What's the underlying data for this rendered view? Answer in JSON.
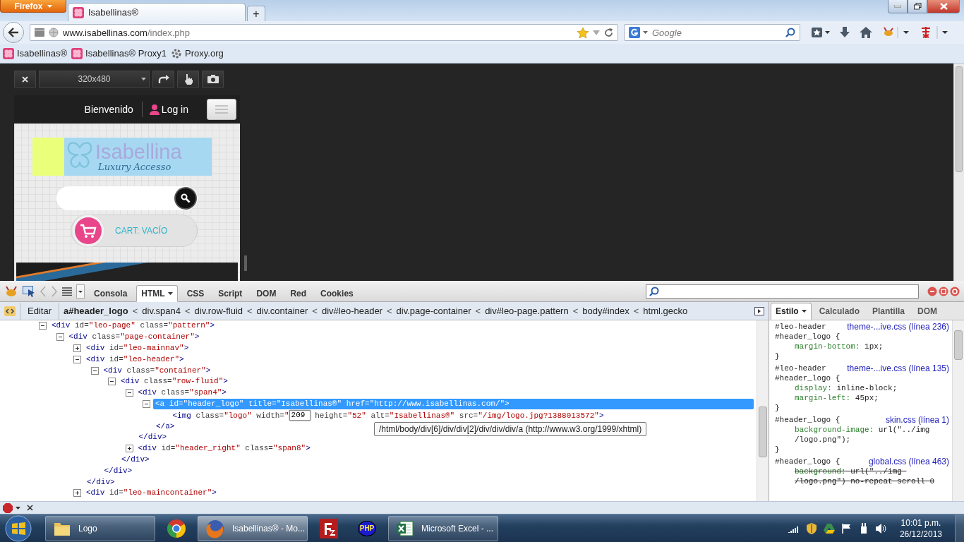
{
  "browser": {
    "app_button": "Firefox",
    "tabs": [
      {
        "title": "Isabellinas®",
        "selected": true
      }
    ],
    "new_tab": "+",
    "url": {
      "host": "www.isabellinas.com",
      "path": "/index.php"
    },
    "search": {
      "placeholder": "Google"
    },
    "bookmarks": [
      {
        "label": "Isabellinas®",
        "kind": "site"
      },
      {
        "label": "Isabellinas® Proxy1",
        "kind": "site"
      },
      {
        "label": "Proxy.org",
        "kind": "proxy"
      }
    ]
  },
  "responsive": {
    "size": "320x480"
  },
  "preview": {
    "welcome": "Bienvenido",
    "login": "Log in",
    "logo_title": "Isabellina",
    "logo_subtitle": "Luxury Accesso",
    "cart": "CART: VACÍO"
  },
  "devtools": {
    "tabs": [
      {
        "label": "Consola",
        "selected": false
      },
      {
        "label": "HTML",
        "selected": true
      },
      {
        "label": "CSS",
        "selected": false
      },
      {
        "label": "Script",
        "selected": false
      },
      {
        "label": "DOM",
        "selected": false
      },
      {
        "label": "Red",
        "selected": false
      },
      {
        "label": "Cookies",
        "selected": false
      }
    ],
    "breadcrumb": {
      "edit": "Editar",
      "separator": "<",
      "items": [
        {
          "label": "a#header_logo",
          "selected": true
        },
        {
          "label": "div.span4",
          "selected": false
        },
        {
          "label": "div.row-fluid",
          "selected": false
        },
        {
          "label": "div.container",
          "selected": false
        },
        {
          "label": "div#leo-header",
          "selected": false
        },
        {
          "label": "div.page-container",
          "selected": false
        },
        {
          "label": "div#leo-page.pattern",
          "selected": false
        },
        {
          "label": "body#index",
          "selected": false
        },
        {
          "label": "html.gecko",
          "selected": false
        }
      ]
    },
    "tree": [
      {
        "expanded": true,
        "selected": false,
        "tokens": [
          {
            "kind": "tag",
            "text": "<div"
          },
          {
            "kind": "attr",
            "text": " id="
          },
          {
            "kind": "value",
            "text": "\"leo-page\""
          },
          {
            "kind": "attr",
            "text": " class="
          },
          {
            "kind": "value",
            "text": "\"pattern\""
          },
          {
            "kind": "tag",
            "text": ">"
          }
        ],
        "children": [
          {
            "expanded": true,
            "selected": false,
            "tokens": [
              {
                "kind": "tag",
                "text": "<div"
              },
              {
                "kind": "attr",
                "text": " class="
              },
              {
                "kind": "value",
                "text": "\"page-container\""
              },
              {
                "kind": "tag",
                "text": ">"
              }
            ],
            "children": [
              {
                "expanded": false,
                "selected": false,
                "tokens": [
                  {
                    "kind": "tag",
                    "text": "<div"
                  },
                  {
                    "kind": "attr",
                    "text": " id="
                  },
                  {
                    "kind": "value",
                    "text": "\"leo-mainnav\""
                  },
                  {
                    "kind": "tag",
                    "text": ">"
                  }
                ]
              },
              {
                "expanded": true,
                "selected": false,
                "tokens": [
                  {
                    "kind": "tag",
                    "text": "<div"
                  },
                  {
                    "kind": "attr",
                    "text": " id="
                  },
                  {
                    "kind": "value",
                    "text": "\"leo-header\""
                  },
                  {
                    "kind": "tag",
                    "text": ">"
                  }
                ],
                "close": "</div>",
                "children": [
                  {
                    "expanded": true,
                    "selected": false,
                    "tokens": [
                      {
                        "kind": "tag",
                        "text": "<div"
                      },
                      {
                        "kind": "attr",
                        "text": " class="
                      },
                      {
                        "kind": "value",
                        "text": "\"container\""
                      },
                      {
                        "kind": "tag",
                        "text": ">"
                      }
                    ],
                    "close": "</div>",
                    "children": [
                      {
                        "expanded": true,
                        "selected": false,
                        "tokens": [
                          {
                            "kind": "tag",
                            "text": "<div"
                          },
                          {
                            "kind": "attr",
                            "text": " class="
                          },
                          {
                            "kind": "value",
                            "text": "\"row-fluid\""
                          },
                          {
                            "kind": "tag",
                            "text": ">"
                          }
                        ],
                        "close": "</div>",
                        "children": [
                          {
                            "expanded": true,
                            "selected": false,
                            "tokens": [
                              {
                                "kind": "tag",
                                "text": "<div"
                              },
                              {
                                "kind": "attr",
                                "text": " class="
                              },
                              {
                                "kind": "value",
                                "text": "\"span4\""
                              },
                              {
                                "kind": "tag",
                                "text": ">"
                              }
                            ],
                            "close": "</div>",
                            "children": [
                              {
                                "expanded": true,
                                "selected": true,
                                "tokens": [
                                  {
                                    "text": "<a id=\"header_logo\" title=\"Isabellinas®\" href=\"http://www.isabellinas.com/\">"
                                  }
                                ],
                                "close": "</a>",
                                "children": [
                                  {
                                    "selected": false,
                                    "tokens": [
                                      {
                                        "kind": "tag",
                                        "text": "<img"
                                      },
                                      {
                                        "kind": "attr",
                                        "text": " class="
                                      },
                                      {
                                        "kind": "value",
                                        "text": "\"logo\""
                                      },
                                      {
                                        "kind": "attr",
                                        "text": " width="
                                      },
                                      {
                                        "kind": "value",
                                        "text": "\""
                                      },
                                      {
                                        "kind": "editor",
                                        "text": "209"
                                      },
                                      {
                                        "kind": "attr",
                                        "text": " height="
                                      },
                                      {
                                        "kind": "value",
                                        "text": "\"52\""
                                      },
                                      {
                                        "kind": "attr",
                                        "text": " alt="
                                      },
                                      {
                                        "kind": "value",
                                        "text": "\"Isabellinas®\""
                                      },
                                      {
                                        "kind": "attr",
                                        "text": " src="
                                      },
                                      {
                                        "kind": "value",
                                        "text": "\"/img/logo.jpg?1388013572\""
                                      },
                                      {
                                        "kind": "tag",
                                        "text": ">"
                                      }
                                    ]
                                  }
                                ]
                              }
                            ]
                          },
                          {
                            "expanded": false,
                            "selected": false,
                            "tokens": [
                              {
                                "kind": "tag",
                                "text": "<div"
                              },
                              {
                                "kind": "attr",
                                "text": " id="
                              },
                              {
                                "kind": "value",
                                "text": "\"header_right\""
                              },
                              {
                                "kind": "attr",
                                "text": " class="
                              },
                              {
                                "kind": "value",
                                "text": "\"span8\""
                              },
                              {
                                "kind": "tag",
                                "text": ">"
                              }
                            ]
                          }
                        ]
                      }
                    ]
                  }
                ]
              },
              {
                "expanded": false,
                "selected": false,
                "tokens": [
                  {
                    "kind": "tag",
                    "text": "<div"
                  },
                  {
                    "kind": "attr",
                    "text": " id="
                  },
                  {
                    "kind": "value",
                    "text": "\"leo-maincontainer\""
                  },
                  {
                    "kind": "tag",
                    "text": ">"
                  }
                ]
              }
            ]
          }
        ]
      }
    ],
    "tooltip": "/html/body/div[6]/div/div[2]/div/div/div/a (http://www.w3.org/1999/xhtml)",
    "side_tabs": [
      {
        "label": "Estilo",
        "selected": true
      },
      {
        "label": "Calculado",
        "selected": false
      },
      {
        "label": "Plantilla",
        "selected": false
      },
      {
        "label": "DOM",
        "selected": false
      }
    ],
    "rules": [
      {
        "selector": [
          "#leo-header",
          "#header_logo {"
        ],
        "source": "theme-...ive.css (línea 236)",
        "declarations": [
          {
            "property": "margin-bottom:",
            "value": "1px;",
            "overridden": false
          }
        ],
        "close": "}"
      },
      {
        "selector": [
          "#leo-header",
          "#header_logo {"
        ],
        "source": "theme-...ive.css (línea 135)",
        "declarations": [
          {
            "property": "display:",
            "value": "inline-block;",
            "overridden": false
          },
          {
            "property": "margin-left:",
            "value": "45px;",
            "overridden": false
          }
        ],
        "close": "}"
      },
      {
        "selector": [
          "#header_logo {"
        ],
        "source": "skin.css (línea 1)",
        "declarations": [
          {
            "property": "background-image:",
            "value": "url(\"../img /logo.png\");",
            "overridden": false
          }
        ],
        "close": "}"
      },
      {
        "selector": [
          "#header_logo {"
        ],
        "source": "global.css (línea 463)",
        "declarations": [
          {
            "property": "background:",
            "value": "url(\"../img /logo.png\") no-repeat scroll 0",
            "overridden": true
          }
        ]
      }
    ]
  },
  "taskbar": {
    "items": [
      {
        "kind": "folder",
        "label": "Logo",
        "running": true,
        "selected": false
      },
      {
        "kind": "chrome",
        "running": false,
        "selected": false
      },
      {
        "kind": "firefox",
        "label": "Isabellinas® - Mo...",
        "running": true,
        "selected": true
      },
      {
        "kind": "filezilla",
        "running": false,
        "selected": false
      },
      {
        "kind": "php",
        "icon_text": "PHP",
        "running": false,
        "selected": false
      },
      {
        "kind": "excel",
        "label": "Microsoft Excel - ...",
        "running": true,
        "selected": false
      }
    ],
    "time": "10:01 p.m.",
    "date": "26/12/2013"
  }
}
